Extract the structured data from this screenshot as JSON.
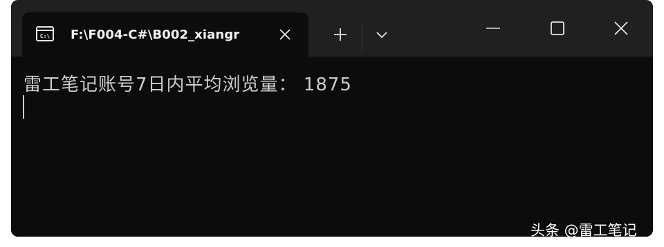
{
  "tab": {
    "title": "F:\\F004-C#\\B002_xiangr",
    "icon": "console-icon",
    "icon_text": "C:\\"
  },
  "toolbar": {
    "new_tab_icon": "plus-icon",
    "dropdown_icon": "chevron-down-icon"
  },
  "window_controls": {
    "minimize_icon": "minimize-icon",
    "maximize_icon": "maximize-icon",
    "close_icon": "close-icon"
  },
  "console": {
    "lines": [
      "雷工笔记账号7日内平均浏览量： 1875"
    ]
  },
  "watermark": {
    "text": "头条 @雷工笔记"
  },
  "colors": {
    "titlebar_bg": "#202020",
    "console_bg": "#0c0c0c",
    "console_text": "#cccccc"
  }
}
